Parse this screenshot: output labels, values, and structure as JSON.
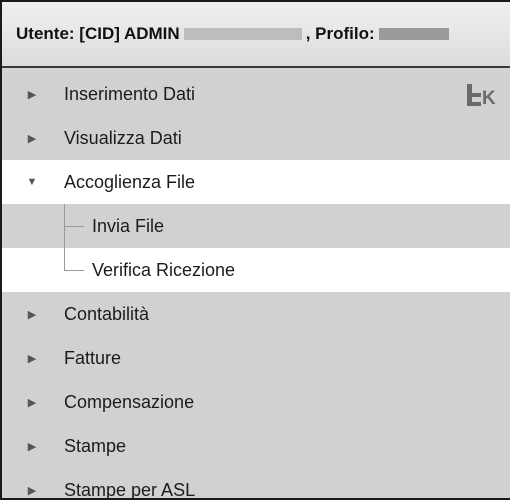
{
  "header": {
    "user_prefix": "Utente: [CID] ADMIN",
    "profile_prefix": ", Profilo:"
  },
  "menu": {
    "items": [
      {
        "label": "Inserimento Dati",
        "state": "collapsed"
      },
      {
        "label": "Visualizza Dati",
        "state": "collapsed"
      },
      {
        "label": "Accoglienza File",
        "state": "expanded",
        "children": [
          {
            "label": "Invia File"
          },
          {
            "label": "Verifica Ricezione"
          }
        ]
      },
      {
        "label": "Contabilità",
        "state": "collapsed"
      },
      {
        "label": "Fatture",
        "state": "collapsed"
      },
      {
        "label": "Compensazione",
        "state": "collapsed"
      },
      {
        "label": "Stampe",
        "state": "collapsed"
      },
      {
        "label": "Stampe per ASL",
        "state": "collapsed"
      }
    ]
  },
  "icons": {
    "exit": "exit-icon",
    "collapsed": "triangle-right-icon",
    "expanded": "triangle-down-icon"
  },
  "colors": {
    "menu_bg": "#d1d1d1",
    "selected_bg": "#ffffff",
    "text": "#1c1c1c"
  }
}
